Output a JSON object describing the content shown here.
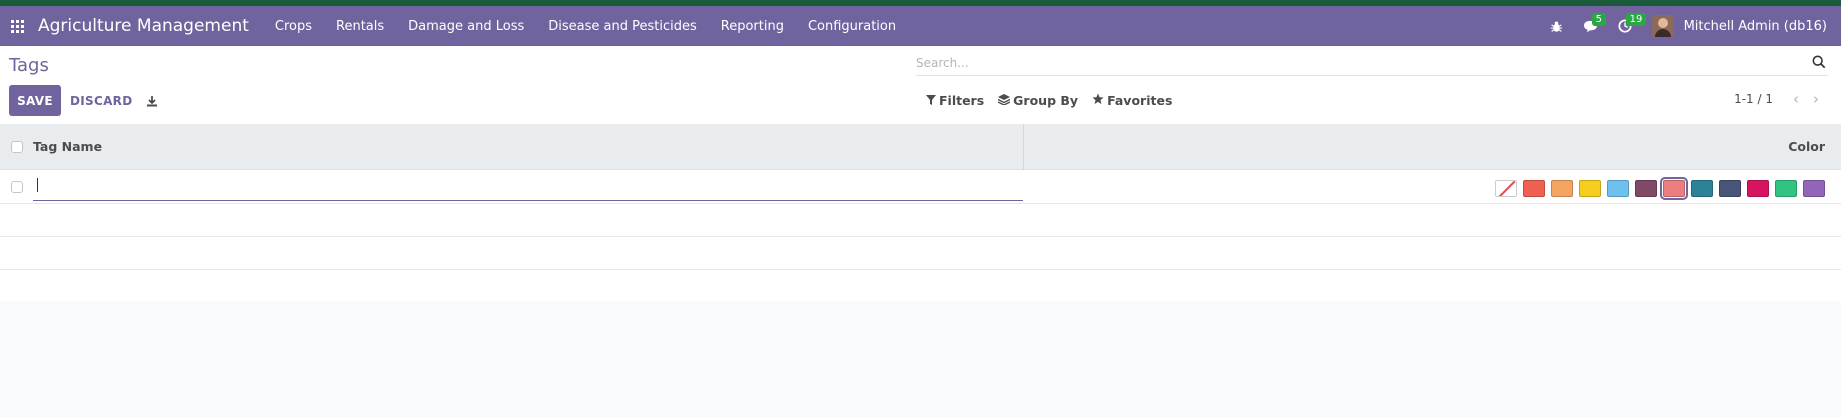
{
  "navbar": {
    "app_name": "Agriculture Management",
    "menu": [
      "Crops",
      "Rentals",
      "Damage and Loss",
      "Disease and Pesticides",
      "Reporting",
      "Configuration"
    ],
    "messages_count": "5",
    "activities_count": "19",
    "user_name": "Mitchell Admin (db16)"
  },
  "control": {
    "title": "Tags",
    "save_label": "SAVE",
    "discard_label": "DISCARD",
    "search_placeholder": "Search...",
    "filters_label": "Filters",
    "groupby_label": "Group By",
    "favorites_label": "Favorites",
    "pager_text": "1-1 / 1"
  },
  "list": {
    "columns": {
      "name": "Tag Name",
      "color": "Color"
    },
    "edit_row": {
      "name_value": ""
    },
    "colors": [
      "#ffffff",
      "#f06050",
      "#f4a460",
      "#f7cd1f",
      "#6cc1ed",
      "#814968",
      "#eb7e7f",
      "#2c8397",
      "#475577",
      "#d6145f",
      "#30c381",
      "#9365b8"
    ],
    "selected_color_index": 6
  },
  "colors": {
    "brand": "#71639e",
    "top_stripe": "#1c5a3c",
    "badge": "#28a745"
  }
}
